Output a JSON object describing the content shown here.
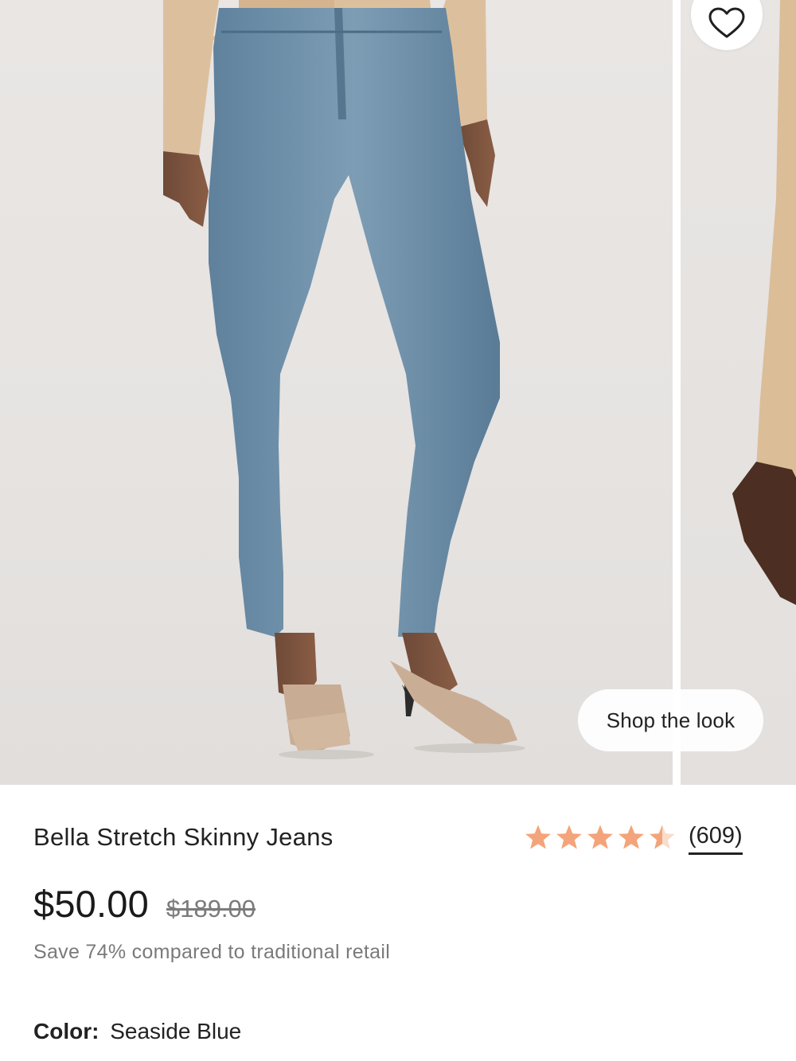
{
  "gallery": {
    "main_image_alt": "",
    "shop_the_look_label": "Shop the look",
    "favorite_icon": "heart-icon"
  },
  "product": {
    "title": "Bella Stretch Skinny Jeans",
    "rating": {
      "value": 4.5,
      "max": 5,
      "review_count_label": "(609)",
      "star_color": "#f4a47a",
      "star_empty_color": "#f9dccb"
    },
    "price": {
      "current": "$50.00",
      "original": "$189.00"
    },
    "savings_note": "Save 74% compared to traditional retail",
    "color": {
      "label": "Color:",
      "value": "Seaside Blue"
    }
  }
}
